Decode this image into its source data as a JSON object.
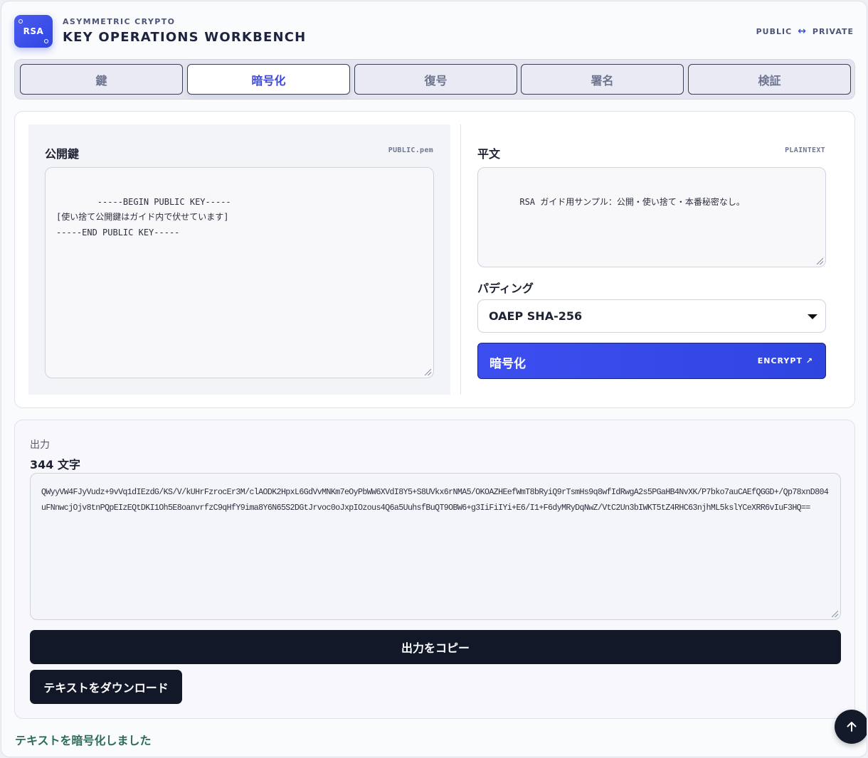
{
  "header": {
    "logo_text": "RSA",
    "eyebrow": "ASYMMETRIC CRYPTO",
    "title": "KEY OPERATIONS WORKBENCH",
    "public_label": "PUBLIC",
    "arrow": "↔",
    "private_label": "PRIVATE"
  },
  "tabs": [
    {
      "label": "鍵",
      "active": false
    },
    {
      "label": "暗号化",
      "active": true
    },
    {
      "label": "復号",
      "active": false
    },
    {
      "label": "署名",
      "active": false
    },
    {
      "label": "検証",
      "active": false
    }
  ],
  "encrypt": {
    "public_key_label": "公開鍵",
    "public_key_tag": "PUBLIC.pem",
    "public_key_value": "-----BEGIN PUBLIC KEY-----\n[使い捨て公開鍵はガイド内で伏せています]\n-----END PUBLIC KEY-----",
    "plaintext_label": "平文",
    "plaintext_tag": "PLAINTEXT",
    "plaintext_value": "RSA ガイド用サンプル：公開・使い捨て・本番秘密なし。",
    "padding_label": "パディング",
    "padding_value": "OAEP SHA-256",
    "button_label": "暗号化",
    "button_sub": "ENCRYPT ↗"
  },
  "output": {
    "label": "出力",
    "count": "344 文字",
    "value": "QWyyVW4FJyVudz+9vVq1dIEzdG/KS/V/kUHrFzrocEr3M/clAODK2HpxL6GdVvMNKm7eOyPbWW6XVdI8Y5+S8UVkx6rNMA5/OKOAZHEefWmT8bRyiQ9rTsmHs9q8wfIdRwgA2s5PGaHB4NvXK/P7bko7auCAEfQGGD+/Qp78xnD804uFNnwcjOjv8tnPQpEIzEQtDKI1Oh5E8oanvrfzC9qHfY9ima8Y6N65S2DGtJrvoc0oJxpIOzous4Q6a5UuhsfBuQT9OBW6+g3IiFiIYi+E6/I1+F6dyMRyDqNwZ/VtC2Un3bIWKT5tZ4RHC63njhML5kslYCeXRR6vIuF3HQ==",
    "copy_label": "出力をコピー",
    "download_label": "テキストをダウンロード"
  },
  "status": "テキストを暗号化しました",
  "colors": {
    "accent": "#3c47e0",
    "dark_button": "#121827",
    "status": "#2d6b5a"
  },
  "icons": {
    "scroll_top": "arrow-up-icon",
    "select": "chevron-down-icon"
  }
}
